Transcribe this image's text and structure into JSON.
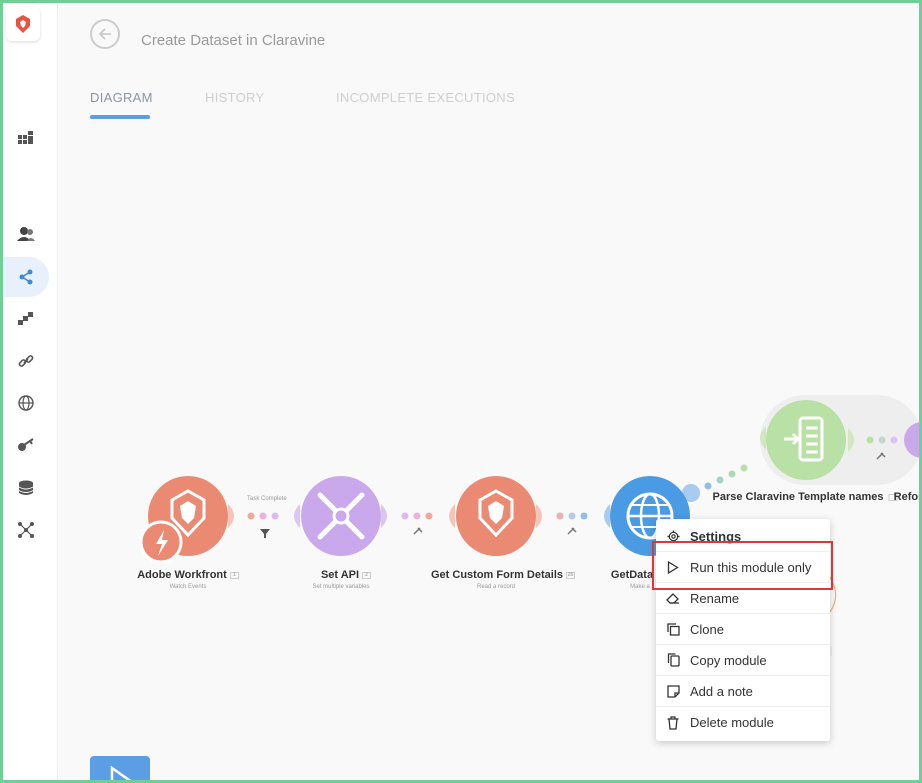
{
  "scenario": {
    "title": "Create Dataset in Claravine"
  },
  "tabs": [
    {
      "label": "DIAGRAM",
      "active": true
    },
    {
      "label": "HISTORY",
      "active": false
    },
    {
      "label": "INCOMPLETE EXECUTIONS",
      "active": false
    }
  ],
  "sidebar": {
    "items": [
      {
        "icon": "templates-icon"
      },
      {
        "icon": "team-icon"
      },
      {
        "icon": "share-icon",
        "active": true
      },
      {
        "icon": "connections-icon"
      },
      {
        "icon": "link-icon"
      },
      {
        "icon": "globe-icon"
      },
      {
        "icon": "key-icon"
      },
      {
        "icon": "database-icon"
      },
      {
        "icon": "flow-icon"
      }
    ]
  },
  "modules": [
    {
      "label": "Adobe Workfront",
      "sub": "Watch Events",
      "tag": "1",
      "color": "#ea8a73"
    },
    {
      "label": "Set API",
      "sub": "Set multiple variables",
      "tag": "2",
      "color": "#c9a8ec"
    },
    {
      "label": "Get Custom Form Details",
      "sub": "Read a record",
      "tag": "25",
      "color": "#ea8a73"
    },
    {
      "label": "GetData",
      "sub": "Make a",
      "tag": "",
      "color": "#4a9be3"
    },
    {
      "label": "Parse Claravine Template names",
      "sub": "",
      "tag": "",
      "color": "#b9e0a5"
    },
    {
      "label": "Refor",
      "sub": "",
      "tag": "",
      "color": "#c9a8ec"
    }
  ],
  "filter_label": "Task Complete",
  "context_menu": {
    "items": [
      {
        "label": "Settings",
        "icon": "gear-icon",
        "bold": true
      },
      {
        "label": "Run this module only",
        "icon": "play-icon",
        "bold": false
      },
      {
        "label": "Rename",
        "icon": "eraser-icon",
        "bold": false
      },
      {
        "label": "Clone",
        "icon": "clone-icon",
        "bold": false
      },
      {
        "label": "Copy module",
        "icon": "copy-icon",
        "bold": false
      },
      {
        "label": "Add a note",
        "icon": "note-icon",
        "bold": false
      },
      {
        "label": "Delete module",
        "icon": "trash-icon",
        "bold": false
      }
    ]
  },
  "colors": {
    "accent": "#5c9ee6",
    "highlight": "#d9393c",
    "frame": "#6fcf97"
  }
}
